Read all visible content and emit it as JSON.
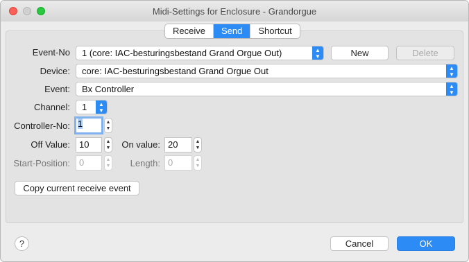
{
  "window": {
    "title": "Midi-Settings for Enclosure - Grandorgue"
  },
  "tabs": [
    {
      "label": "Receive",
      "active": false
    },
    {
      "label": "Send",
      "active": true
    },
    {
      "label": "Shortcut",
      "active": false
    }
  ],
  "form": {
    "event_no": {
      "label": "Event-No",
      "value": "1 (core: IAC-besturingsbestand Grand Orgue Out)",
      "new_label": "New",
      "delete_label": "Delete"
    },
    "device": {
      "label": "Device:",
      "value": "core: IAC-besturingsbestand Grand Orgue Out"
    },
    "event": {
      "label": "Event:",
      "value": "Bx Controller"
    },
    "channel": {
      "label": "Channel:",
      "value": "1"
    },
    "controller_no": {
      "label": "Controller-No:",
      "value": "1"
    },
    "off_value": {
      "label": "Off Value:",
      "value": "10"
    },
    "on_value": {
      "label": "On value:",
      "value": "20"
    },
    "start_position": {
      "label": "Start-Position:",
      "value": "0"
    },
    "length": {
      "label": "Length:",
      "value": "0"
    },
    "copy_button": "Copy current receive event"
  },
  "footer": {
    "help": "?",
    "cancel": "Cancel",
    "ok": "OK"
  },
  "colors": {
    "accent": "#2d8bf5",
    "close": "#fe5f57",
    "maximize": "#28c940"
  },
  "icons": [
    "close-icon",
    "minimize-icon",
    "maximize-icon",
    "chevron-updown-icon",
    "stepper-icon"
  ]
}
